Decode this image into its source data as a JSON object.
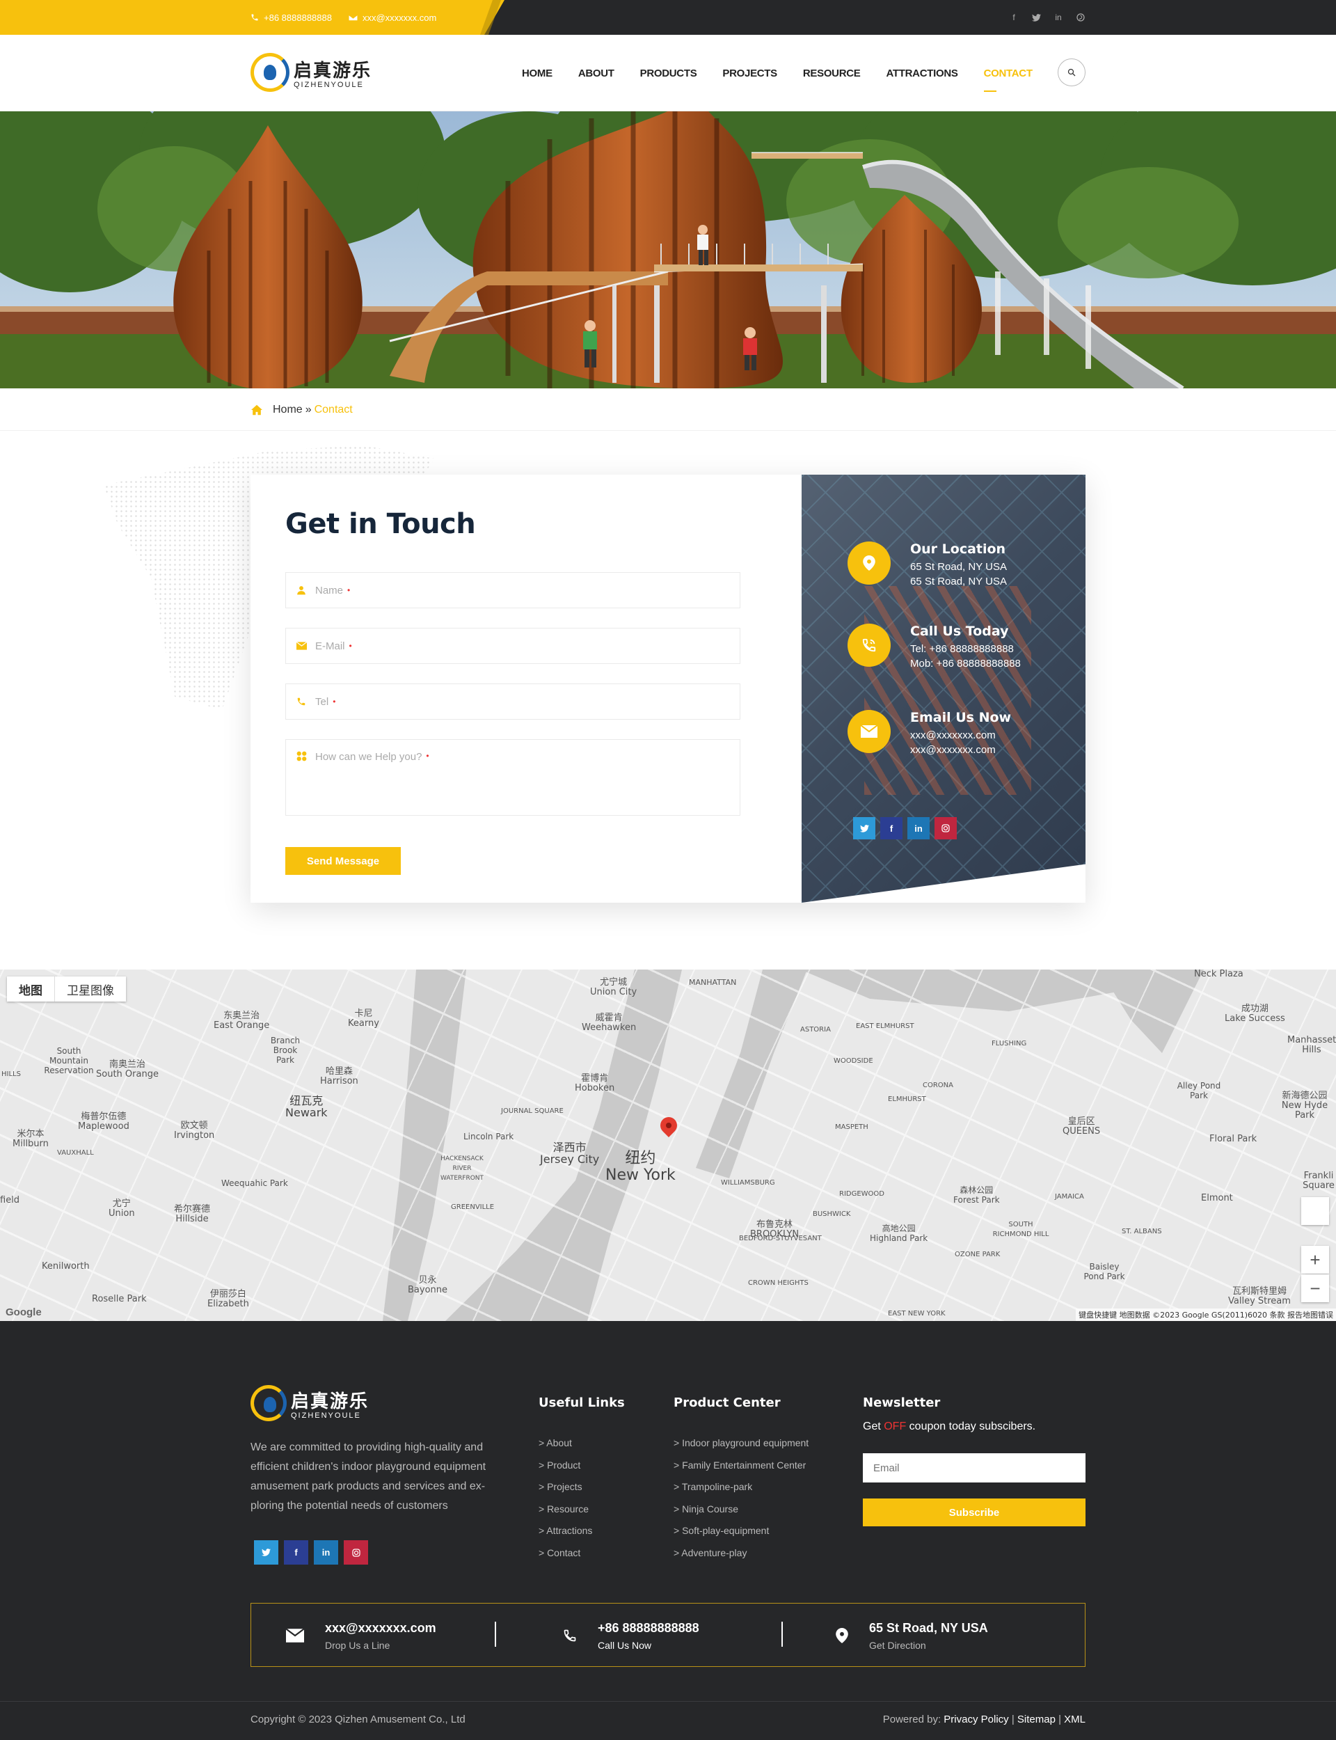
{
  "topbar": {
    "phone": "+86 8888888888",
    "email": "xxx@xxxxxxx.com",
    "social": [
      "facebook-icon",
      "twitter-icon",
      "linkedin-icon",
      "pinterest-icon"
    ]
  },
  "header": {
    "logo_cn": "启真游乐",
    "logo_en": "QIZHENYOULE",
    "nav": [
      "HOME",
      "ABOUT",
      "PRODUCTS",
      "PROJECTS",
      "RESOURCE",
      "ATTRACTIONS",
      "CONTACT"
    ],
    "active_nav": "CONTACT"
  },
  "breadcrumb": {
    "home": "Home",
    "sep": "»",
    "current": "Contact"
  },
  "form": {
    "title": "Get in Touch",
    "name_placeholder": "Name",
    "email_placeholder": "E-Mail",
    "tel_placeholder": "Tel",
    "message_placeholder": "How can we Help you?",
    "required_mark": "•",
    "submit_label": "Send Message"
  },
  "info": {
    "location": {
      "title": "Our Location",
      "line1": "65 St Road, NY USA",
      "line2": "65 St Road, NY USA"
    },
    "call": {
      "title": "Call Us Today",
      "line1": "Tel: +86 88888888888",
      "line2": "Mob: +86 88888888888"
    },
    "email": {
      "title": "Email Us Now",
      "line1": "xxx@xxxxxxx.com",
      "line2": "xxx@xxxxxxx.com"
    }
  },
  "map": {
    "tab_map": "地图",
    "tab_satellite": "卫星图像",
    "labels": {
      "newyork_cn": "纽约",
      "newyork_en": "New York",
      "jersey_cn": "泽西市",
      "jersey_en": "Jersey City",
      "newark_cn": "纽瓦克",
      "newark_en": "Newark",
      "queens_cn": "皇后区",
      "queens_en": "QUEENS",
      "brooklyn_cn": "布鲁克林",
      "brooklyn_en": "BROOKLYN",
      "hoboken_cn": "霍博肯",
      "hoboken_en": "Hoboken",
      "unioncity_cn": "尤宁城",
      "unioncity_en": "Union City",
      "weehawken_cn": "威霍肯",
      "weehawken_en": "Weehawken",
      "kearny_cn": "卡尼",
      "kearny_en": "Kearny",
      "harrison_cn": "哈里森",
      "harrison_en": "Harrison",
      "eastorange_cn": "东奥兰治",
      "eastorange_en": "East Orange",
      "southorange_cn": "南奥兰治",
      "southorange_en": "South Orange",
      "maplewood_cn": "梅普尔伍德",
      "maplewood_en": "Maplewood",
      "irvington_cn": "欧文顿",
      "irvington_en": "Irvington",
      "millburn_cn": "米尔本",
      "millburn_en": "Millburn",
      "union_cn": "尤宁",
      "union_en": "Union",
      "hillside_cn": "希尔赛德",
      "hillside_en": "Hillside",
      "elizabeth_cn": "伊丽莎白",
      "elizabeth_en": "Elizabeth",
      "bayonne_cn": "贝永",
      "bayonne_en": "Bayonne",
      "kenilworth": "Kenilworth",
      "roselle": "Roselle Park",
      "manhattan": "MANHATTAN",
      "astoria": "ASTORIA",
      "lakesuccess_cn": "成功湖",
      "lakesuccess_en": "Lake Success",
      "newhydepark_cn": "新海德公园",
      "newhydepark_en": "New Hyde Park",
      "manhasset": "Manhasset Hills",
      "floralpark": "Floral Park",
      "elmont": "Elmont",
      "valleystream_cn": "瓦利斯特里姆",
      "valleystream_en": "Valley Stream",
      "neckplaza": "Neck Plaza",
      "alleypond": "Alley Pond Park",
      "forestpark_cn": "森林公园",
      "forestpark_en": "Forest Park",
      "highland_cn": "高地公园",
      "highland_en": "Highland Park",
      "flushing": "FLUSHING",
      "corona": "CORONA",
      "elmhurst": "ELMHURST",
      "maspeth": "MASPETH",
      "bushwick": "BUSHWICK",
      "ridgewood": "RIDGEWOOD",
      "williamsburg": "WILLIAMSBURG",
      "bedford": "BEDFORD-STUYVESANT",
      "crownheights": "CROWN HEIGHTS",
      "jamaica": "JAMAICA",
      "ozonepark": "OZONE PARK",
      "richmondhill": "SOUTH RICHMOND HILL",
      "greenville": "GREENVILLE",
      "journalsquare": "JOURNAL SQUARE",
      "lincolnpark": "Lincoln Park",
      "weequahic": "Weequahic Park",
      "southmountain": "South Mountain Reservation",
      "branchbrook": "Branch Brook Park",
      "woodside": "WOODSIDE",
      "hackensack": "HACKENSACK RIVER WATERFRONT",
      "elmhurst_east": "EAST ELMHURST",
      "stalbans": "ST. ALBANS",
      "baisley": "Baisley Pond Park",
      "franklin": "Frankli Square",
      "fieldtxt": "field",
      "hills": "HILLS",
      "vauxhall": "VAUXHALL",
      "eastnewyork": "EAST NEW YORK"
    },
    "footer": "键盘快捷键   地图数据 ©2023 Google GS(2011)6020   条款   报告地图错误",
    "google": "Google"
  },
  "footer": {
    "logo_cn": "启真游乐",
    "logo_en": "QIZHENYOULE",
    "description": "We are committed to providing high-quality and efficient children's indoor playground equipment amusement park products and services and ex-ploring the potential needs of customers",
    "useful_links_title": "Useful Links",
    "useful_links": [
      "> About",
      "> Product",
      "> Projects",
      "> Resource",
      "> Attractions",
      "> Contact"
    ],
    "product_center_title": "Product Center",
    "products": [
      "> Indoor playground equipment",
      "> Family Entertainment Center",
      "> Trampoline-park",
      "> Ninja Course",
      "> Soft-play-equipment",
      "> Adventure-play"
    ],
    "newsletter_title": "Newsletter",
    "newsletter_pre": "Get ",
    "newsletter_off": "OFF",
    "newsletter_post": " coupon today subscibers.",
    "email_placeholder": "Email",
    "subscribe_label": "Subscribe",
    "contact_email": "xxx@xxxxxxx.com",
    "contact_email_sub": "Drop Us a Line",
    "contact_phone": "+86 88888888888",
    "contact_phone_sub": "Call Us Now",
    "contact_addr": "65 St Road, NY USA",
    "contact_addr_sub": "Get Direction",
    "copyright": "Copyright © 2023 Qizhen Amusement Co., Ltd",
    "powered_prefix": "Powered by: ",
    "privacy": "Privacy Policy",
    "sitemap": "Sitemap",
    "xml": "XML",
    "sep": " | "
  }
}
